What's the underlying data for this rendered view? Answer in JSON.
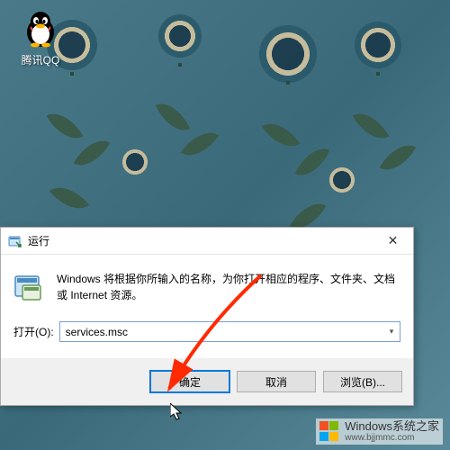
{
  "desktop": {
    "icons": [
      {
        "app": "tencent-qq",
        "label": "腾讯QQ"
      }
    ]
  },
  "dialog": {
    "title": "运行",
    "description": "Windows 将根据你所输入的名称，为你打开相应的程序、文件夹、文档或 Internet 资源。",
    "open_label": "打开(O):",
    "open_value": "services.msc",
    "buttons": {
      "ok": "确定",
      "cancel": "取消",
      "browse": "浏览(B)..."
    },
    "close_tooltip": "关闭"
  },
  "watermark": {
    "brand": "Windows系统之家",
    "url": "www.bjjmmc.com",
    "colors": {
      "tl": "#f25022",
      "tr": "#7fba00",
      "bl": "#00a4ef",
      "br": "#ffb900"
    }
  },
  "icons": {
    "run": "run-program-icon",
    "chevron": "▾",
    "close": "✕"
  }
}
